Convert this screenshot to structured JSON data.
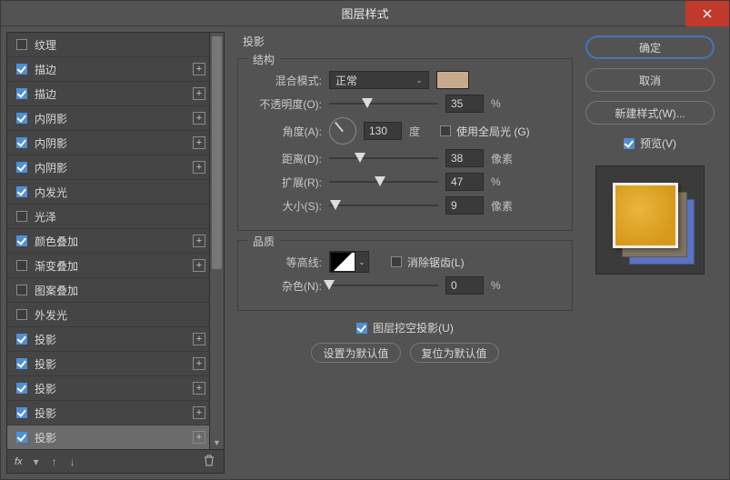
{
  "window": {
    "title": "图层样式"
  },
  "buttons": {
    "ok": "确定",
    "cancel": "取消",
    "new_style": "新建样式(W)...",
    "preview": "预览(V)",
    "set_default": "设置为默认值",
    "reset_default": "复位为默认值"
  },
  "left_panel": {
    "items": [
      {
        "name": "纹理",
        "checked": false,
        "addable": false
      },
      {
        "name": "描边",
        "checked": true,
        "addable": true
      },
      {
        "name": "描边",
        "checked": true,
        "addable": true
      },
      {
        "name": "内阴影",
        "checked": true,
        "addable": true
      },
      {
        "name": "内阴影",
        "checked": true,
        "addable": true
      },
      {
        "name": "内阴影",
        "checked": true,
        "addable": true
      },
      {
        "name": "内发光",
        "checked": true,
        "addable": false
      },
      {
        "name": "光泽",
        "checked": false,
        "addable": false
      },
      {
        "name": "颜色叠加",
        "checked": true,
        "addable": true
      },
      {
        "name": "渐变叠加",
        "checked": false,
        "addable": true
      },
      {
        "name": "图案叠加",
        "checked": false,
        "addable": false
      },
      {
        "name": "外发光",
        "checked": false,
        "addable": false
      },
      {
        "name": "投影",
        "checked": true,
        "addable": true
      },
      {
        "name": "投影",
        "checked": true,
        "addable": true
      },
      {
        "name": "投影",
        "checked": true,
        "addable": true
      },
      {
        "name": "投影",
        "checked": true,
        "addable": true
      },
      {
        "name": "投影",
        "checked": true,
        "addable": true,
        "selected": true
      }
    ],
    "fx_label": "fx"
  },
  "mid": {
    "panel_title": "投影",
    "structure": {
      "legend": "结构",
      "blend_mode_label": "混合模式:",
      "blend_mode_value": "正常",
      "opacity_label": "不透明度(O):",
      "opacity_value": "35",
      "opacity_unit": "%",
      "angle_label": "角度(A):",
      "angle_value": "130",
      "angle_unit": "度",
      "use_global": "使用全局光 (G)",
      "distance_label": "距离(D):",
      "distance_value": "38",
      "distance_unit": "像素",
      "spread_label": "扩展(R):",
      "spread_value": "47",
      "spread_unit": "%",
      "size_label": "大小(S):",
      "size_value": "9",
      "size_unit": "像素"
    },
    "quality": {
      "legend": "品质",
      "contour_label": "等高线:",
      "antialias": "消除锯齿(L)",
      "noise_label": "杂色(N):",
      "noise_value": "0",
      "noise_unit": "%"
    },
    "knockout": "图层挖空投影(U)"
  },
  "colors": {
    "swatch": "#c9a98e"
  }
}
